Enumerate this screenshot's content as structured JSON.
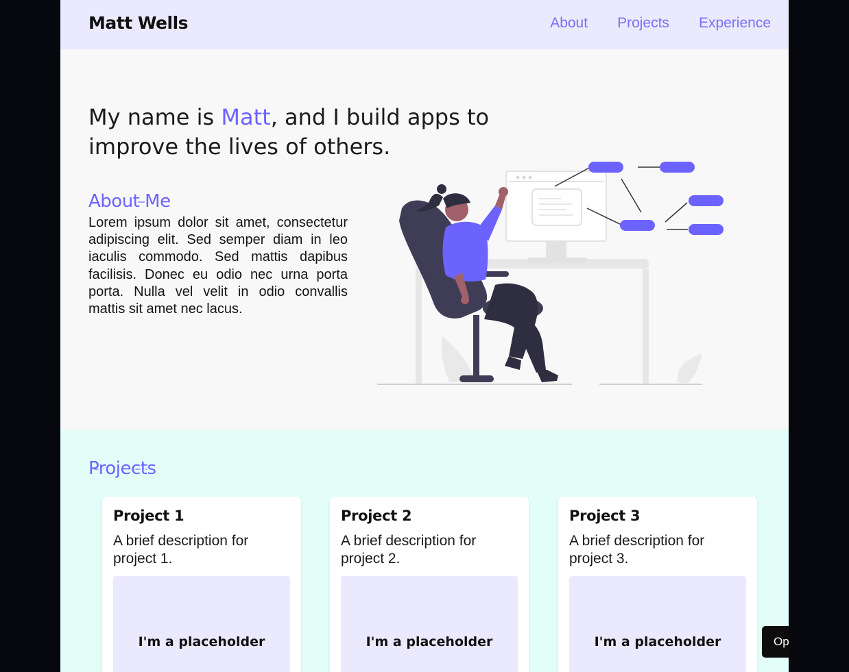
{
  "header": {
    "brand": "Matt Wells",
    "nav": [
      "About",
      "Projects",
      "Experience"
    ]
  },
  "hero": {
    "prefix": "My name is ",
    "name": "Matt",
    "suffix": ", and I build apps to improve the lives of others."
  },
  "about": {
    "title": "About Me",
    "body": "Lorem ipsum dolor sit amet, consectetur adipiscing elit. Sed semper diam in leo iaculis commodo. Sed mattis dapibus facilisis. Donec eu odio nec urna porta porta. Nulla vel velit in odio convallis mattis sit amet nec lacus."
  },
  "projects": {
    "title": "Projects",
    "cards": [
      {
        "title": "Project 1",
        "desc": "A brief description for project 1.",
        "placeholder": "I'm a placeholder"
      },
      {
        "title": "Project 2",
        "desc": "A brief description for project 2.",
        "placeholder": "I'm a placeholder"
      },
      {
        "title": "Project 3",
        "desc": "A brief description for project 3.",
        "placeholder": "I'm a placeholder"
      }
    ]
  },
  "floating_button": "Op",
  "colors": {
    "accent": "#6c63ff",
    "nav_bg": "#ebe9fe",
    "projects_bg": "#e3fdf8"
  },
  "illustration_icon": "person-at-desk-illustration"
}
